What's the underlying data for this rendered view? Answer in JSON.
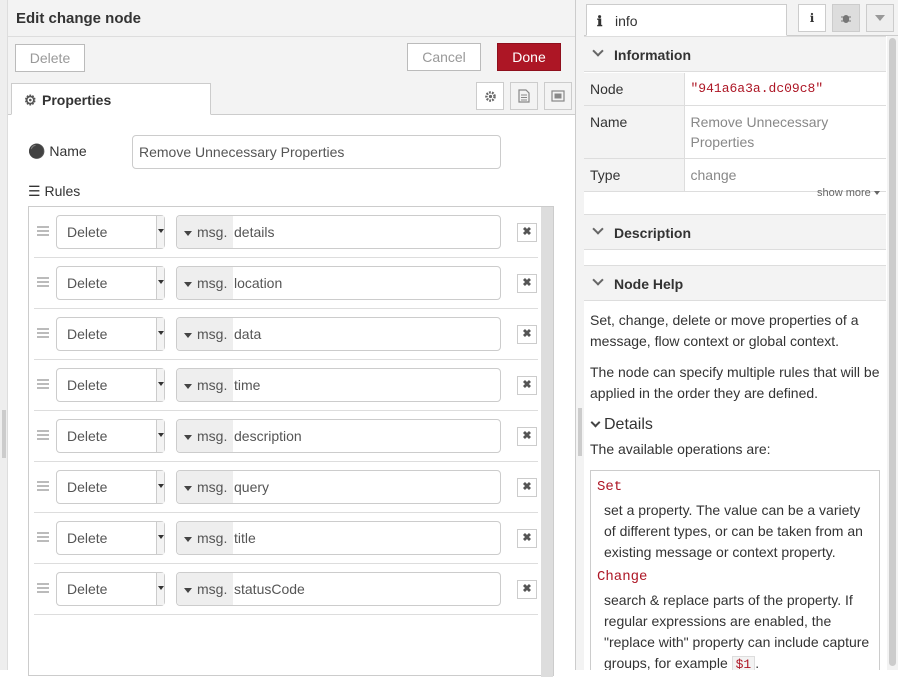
{
  "tray": {
    "title": "Edit change node",
    "delete_label": "Delete",
    "cancel_label": "Cancel",
    "done_label": "Done",
    "tab_label": "Properties",
    "tab_icon": "gear-icon",
    "name_label": "Name",
    "name_value": "Remove Unnecessary Properties",
    "rules_label": "Rules",
    "rules": [
      {
        "action": "Delete",
        "type": "msg.",
        "property": "details"
      },
      {
        "action": "Delete",
        "type": "msg.",
        "property": "location"
      },
      {
        "action": "Delete",
        "type": "msg.",
        "property": "data"
      },
      {
        "action": "Delete",
        "type": "msg.",
        "property": "time"
      },
      {
        "action": "Delete",
        "type": "msg.",
        "property": "description"
      },
      {
        "action": "Delete",
        "type": "msg.",
        "property": "query"
      },
      {
        "action": "Delete",
        "type": "msg.",
        "property": "title"
      },
      {
        "action": "Delete",
        "type": "msg.",
        "property": "statusCode"
      }
    ],
    "remove_symbol": "✖"
  },
  "sidebar": {
    "tab_label": "info",
    "information_title": "Information",
    "info_rows": [
      {
        "key": "Node",
        "value": "\"941a6a3a.dc09c8\""
      },
      {
        "key": "Name",
        "value": "Remove Unnecessary Properties"
      },
      {
        "key": "Type",
        "value": "change"
      }
    ],
    "show_more": "show more",
    "description_title": "Description",
    "node_help_title": "Node Help",
    "help_p1": "Set, change, delete or move properties of a message, flow context or global context.",
    "help_p2": "The node can specify multiple rules that will be applied in the order they are defined.",
    "details_title": "Details",
    "ops_intro": "The available operations are:",
    "ops": {
      "set_name": "Set",
      "set_desc": "set a property. The value can be a variety of different types, or can be taken from an existing message or context property.",
      "change_name": "Change",
      "change_desc_pre": "search & replace parts of the property. If regular expressions are enabled, the \"replace with\" property can include capture groups, for example",
      "change_code": "$1",
      "change_desc_post": "."
    }
  }
}
